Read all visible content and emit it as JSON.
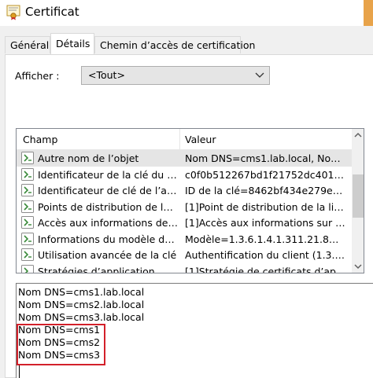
{
  "window": {
    "title": "Certificat",
    "accent_color": "#e8a34a"
  },
  "tabs": [
    {
      "label": "Général"
    },
    {
      "label": "Détails"
    },
    {
      "label": "Chemin d’accès de certification"
    }
  ],
  "afficher": {
    "label": "Afficher :",
    "value": "<Tout>"
  },
  "list": {
    "columns": [
      "Champ",
      "Valeur"
    ],
    "rows": [
      {
        "champ": "Autre nom de l’objet",
        "valeur": "Nom DNS=cms1.lab.local, Nom…",
        "icon": "cert-field-icon"
      },
      {
        "champ": "Identificateur de la clé du s…",
        "valeur": "c0f0b512267bd1f21752dc401…",
        "icon": "cert-field-icon"
      },
      {
        "champ": "Identificateur de clé de l’aut…",
        "valeur": "ID de la clé=8462bf434e279e…",
        "icon": "cert-field-icon"
      },
      {
        "champ": "Points de distribution de la li…",
        "valeur": "[1]Point de distribution de la lis…",
        "icon": "cert-field-icon"
      },
      {
        "champ": "Accès aux informations de l’…",
        "valeur": "[1]Accès aux informations sur …",
        "icon": "cert-field-icon"
      },
      {
        "champ": "Informations du modèle de …",
        "valeur": "Modèle=1.3.6.1.4.1.311.21.8…",
        "icon": "cert-field-icon"
      },
      {
        "champ": "Utilisation avancée de la clé",
        "valeur": "Authentification du client (1.3.…",
        "icon": "cert-field-icon"
      },
      {
        "champ": "Stratégies d’application",
        "valeur": "[1]Stratégie de certificats d’ap…",
        "icon": "cert-field-icon"
      }
    ]
  },
  "detail_lines": [
    "Nom DNS=cms1.lab.local",
    "Nom DNS=cms2.lab.local",
    "Nom DNS=cms3.lab.local",
    "Nom DNS=cms1",
    "Nom DNS=cms2",
    "Nom DNS=cms3"
  ],
  "highlight_color": "#d3202a"
}
